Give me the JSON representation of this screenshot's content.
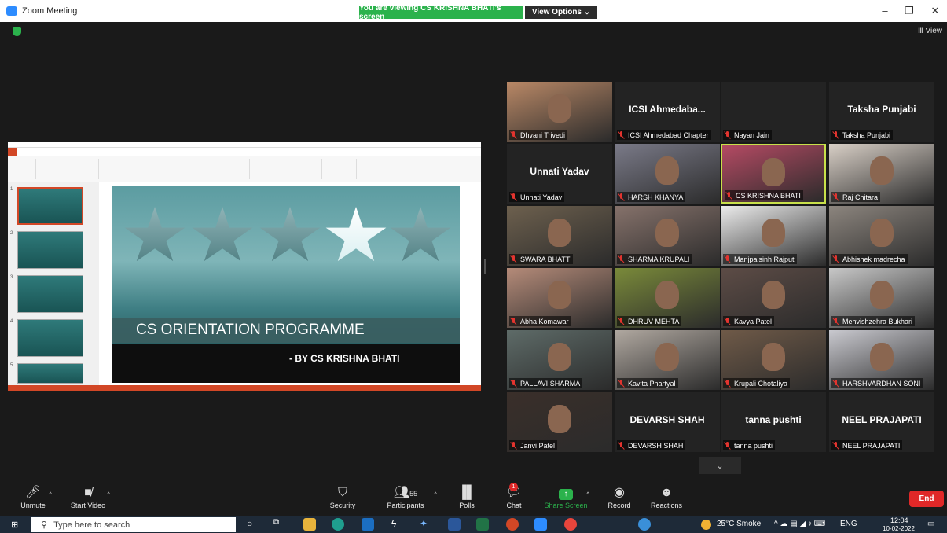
{
  "window": {
    "title": "Zoom Meeting",
    "banner": "You are viewing CS KRISHNA BHATI's screen",
    "view_options": "View Options ⌄",
    "view": "Ⅲ View"
  },
  "slide": {
    "title": "CS ORIENTATION PROGRAMME",
    "subtitle": "- BY CS KRISHNA BHATI",
    "thumb_numbers": [
      "1",
      "2",
      "3",
      "4",
      "5"
    ]
  },
  "participants": [
    {
      "label": "Dhvani Trivedi",
      "big": "",
      "video": true,
      "color": "#b98866"
    },
    {
      "label": "ICSI Ahmedabad Chapter",
      "big": "ICSI  Ahmedaba...",
      "video": false
    },
    {
      "label": "Nayan Jain",
      "big": "",
      "video": false
    },
    {
      "label": "Taksha Punjabi",
      "big": "Taksha Punjabi",
      "video": false
    },
    {
      "label": "Unnati Yadav",
      "big": "Unnati Yadav",
      "video": false
    },
    {
      "label": "HARSH KHANYA",
      "big": "",
      "video": true,
      "color": "#7a7a88"
    },
    {
      "label": "CS KRISHNA BHATI",
      "big": "",
      "video": true,
      "color": "#b44a63",
      "active": true
    },
    {
      "label": "Raj Chitara",
      "big": "",
      "video": true,
      "color": "#d8cfc6"
    },
    {
      "label": "SWARA BHATT",
      "big": "",
      "video": true,
      "color": "#6d604e"
    },
    {
      "label": "SHARMA KRUPALI",
      "big": "",
      "video": true,
      "color": "#86726b"
    },
    {
      "label": "Manjpalsinh Rajput",
      "big": "",
      "video": true,
      "color": "#ececec"
    },
    {
      "label": "Abhishek madrecha",
      "big": "",
      "video": true,
      "color": "#8c857e"
    },
    {
      "label": "Abha Komawar",
      "big": "",
      "video": true,
      "color": "#b58b79"
    },
    {
      "label": "DHRUV MEHTA",
      "big": "",
      "video": true,
      "color": "#7a8a3a"
    },
    {
      "label": "Kavya Patel",
      "big": "",
      "video": true,
      "color": "#5d4c46"
    },
    {
      "label": "Mehvishzehra Bukhari",
      "big": "",
      "video": true,
      "color": "#c8c8c8"
    },
    {
      "label": "PALLAVI SHARMA",
      "big": "",
      "video": true,
      "color": "#5e6b68"
    },
    {
      "label": "Kavita Phartyal",
      "big": "",
      "video": true,
      "color": "#b0a8a0"
    },
    {
      "label": "Krupali Chotaliya",
      "big": "",
      "video": true,
      "color": "#6f5a48"
    },
    {
      "label": "HARSHVARDHAN SONI",
      "big": "",
      "video": true,
      "color": "#c9c9cf"
    },
    {
      "label": "Janvi Patel",
      "big": "",
      "video": true,
      "color": "#3a2f2a"
    },
    {
      "label": "DEVARSH SHAH",
      "big": "DEVARSH SHAH",
      "video": false
    },
    {
      "label": "tanna pushti",
      "big": "tanna pushti",
      "video": false
    },
    {
      "label": "NEEL PRAJAPATI",
      "big": "NEEL PRAJAPATI",
      "video": false
    }
  ],
  "toolbar": {
    "unmute": "Unmute",
    "start_video": "Start Video",
    "security": "Security",
    "participants": "Participants",
    "participant_count": "55",
    "polls": "Polls",
    "chat": "Chat",
    "chat_badge": "1",
    "share_screen": "Share Screen",
    "record": "Record",
    "reactions": "Reactions",
    "end": "End"
  },
  "taskbar": {
    "search_placeholder": "Type here to search",
    "weather": "25°C  Smoke",
    "lang": "ENG",
    "time": "12:04",
    "date": "10-02-2022"
  },
  "colors": {
    "accent": "#2bb24c",
    "end": "#e02828",
    "slide_orange": "#d24726"
  }
}
